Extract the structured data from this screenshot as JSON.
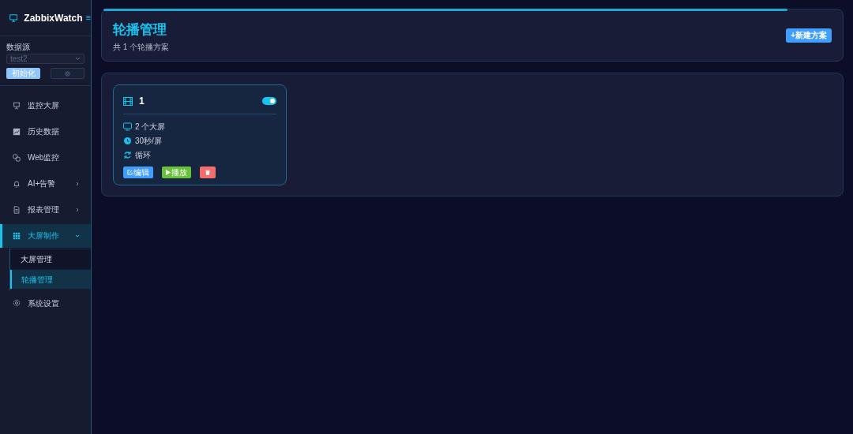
{
  "brand": {
    "title": "ZabbixWatch",
    "menu_glyph": "≡"
  },
  "datasource": {
    "label": "数据源",
    "value": "test2",
    "init_button": "初始化"
  },
  "sidebar": {
    "items": [
      {
        "label": "监控大屏",
        "selected": false
      },
      {
        "label": "历史数据",
        "selected": false
      },
      {
        "label": "Web监控",
        "selected": false
      },
      {
        "label": "AI+告警",
        "selected": false,
        "expanded": false
      },
      {
        "label": "报表管理",
        "selected": false,
        "expanded": false
      },
      {
        "label": "大屏制作",
        "selected": true,
        "expanded": true,
        "children": [
          {
            "label": "大屏管理",
            "selected": false
          },
          {
            "label": "轮播管理",
            "selected": true
          }
        ]
      },
      {
        "label": "系统设置",
        "selected": false
      }
    ]
  },
  "header": {
    "title": "轮播管理",
    "subtitle": "共 1 个轮播方案",
    "new_button": "+新建方案"
  },
  "plans": [
    {
      "title": "1",
      "on": true,
      "screens": "2 个大屏",
      "interval": "30秒/屏",
      "mode": "循环",
      "buttons": [
        {
          "kind": "edit",
          "label": "编辑"
        },
        {
          "kind": "play",
          "label": "播放"
        },
        {
          "kind": "delete"
        }
      ]
    }
  ]
}
